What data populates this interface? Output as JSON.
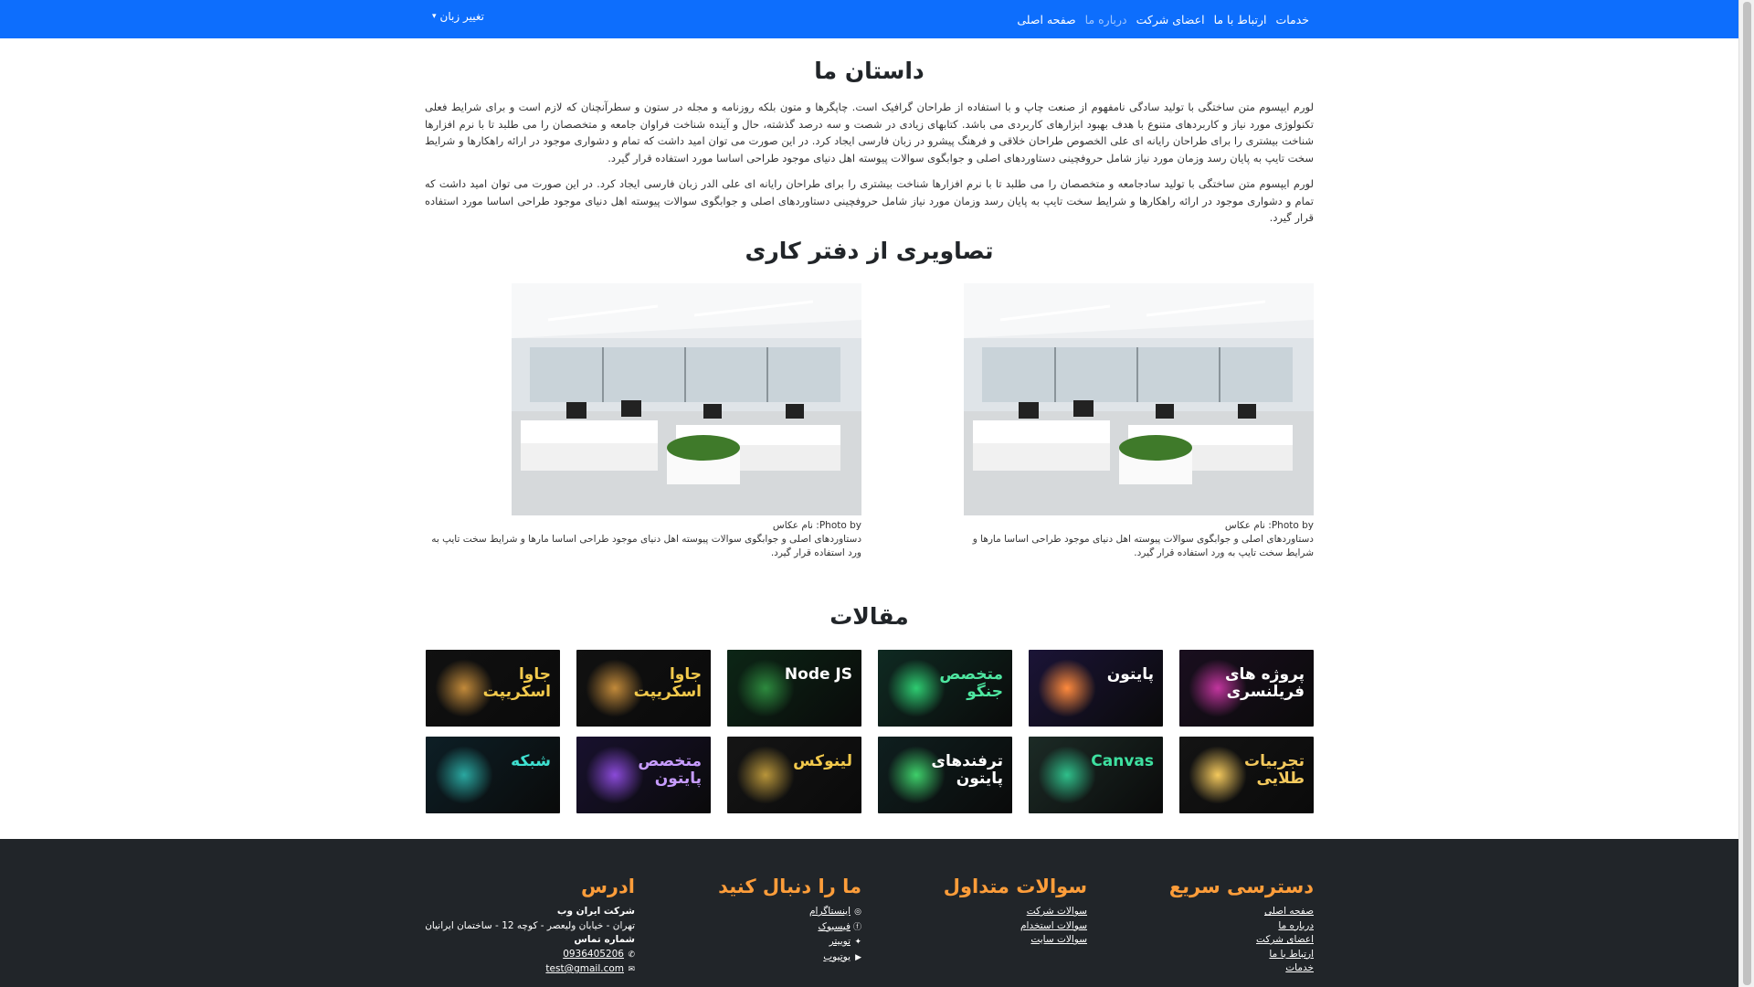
{
  "navbar": {
    "links": [
      {
        "label": "صفحه اصلی",
        "active": false
      },
      {
        "label": "درباره ما",
        "active": true
      },
      {
        "label": "اعضای شرکت",
        "active": false
      },
      {
        "label": "ارتباط با ما",
        "active": false
      },
      {
        "label": "خدمات",
        "active": false
      }
    ],
    "language_toggle": "تغییر زبان",
    "color": "#0d6efd"
  },
  "story": {
    "title": "داستان ما",
    "paragraphs": [
      "لورم ایپسوم متن ساختگی با تولید سادگی نامفهوم از صنعت چاپ و با استفاده از طراحان گرافیک است. چاپگرها و متون بلکه روزنامه و مجله در ستون و سطرآنچنان که لازم است و برای شرایط فعلی تکنولوژی مورد نیاز و کاربردهای متنوع با هدف بهبود ابزارهای کاربردی می باشد. کتابهای زیادی در شصت و سه درصد گذشته، حال و آینده شناخت فراوان جامعه و متخصصان را می طلبد تا با نرم افزارها شناخت بیشتری را برای طراحان رایانه ای علی الخصوص طراحان خلاقی و فرهنگ پیشرو در زبان فارسی ایجاد کرد. در این صورت می توان امید داشت که تمام و دشواری موجود در ارائه راهکارها و شرایط سخت تایپ به پایان رسد وزمان مورد نیاز شامل حروفچینی دستاوردهای اصلی و جوابگوی سوالات پیوسته اهل دنیای موجود طراحی اساسا مورد استفاده قرار گیرد.",
      "لورم ایپسوم متن ساختگی با تولید سادجامعه و متخصصان را می طلبد تا با نرم افزارها شناخت بیشتری را برای طراحان رایانه ای علی الدر زبان فارسی ایجاد کرد. در این صورت می توان امید داشت که تمام و دشواری موجود در ارائه راهکارها و شرایط سخت تایپ به پایان رسد وزمان مورد نیاز شامل حروفچینی دستاوردهای اصلی و جوابگوی سوالات پیوسته اهل دنیای موجود طراحی اساسا مورد استفاده قرار گیرد."
    ]
  },
  "office": {
    "title": "تصاویری از دفتر کاری",
    "photos": [
      {
        "credit": "Photo by: نام عکاس",
        "caption": "دستاوردهای اصلی و جوابگوی سوالات پیوسته اهل دنیای موجود طراحی اساسا مارها و شرایط سخت تایپ به ورد استفاده قرار گیرد."
      },
      {
        "credit": "Photo by: نام عکاس",
        "caption": "دستاوردهای اصلی و جوابگوی سوالات پیوسته اهل دنیای موجود طراحی اساسا مارها و شرایط سخت تایپ به ورد استفاده قرار گیرد."
      }
    ]
  },
  "articles": {
    "title": "مقالات",
    "items": [
      {
        "title": "پروژه های\nفریلنسری",
        "bg": "#1a0f1f",
        "art": "#c2359e",
        "color": "#ffffff"
      },
      {
        "title": "پایتون",
        "bg": "#1b1437",
        "art": "#ff8a3d",
        "color": "#ffffff"
      },
      {
        "title": "متخصص\nجنگو",
        "bg": "#0f2a22",
        "art": "#2ecc71",
        "color": "#4ee6a0"
      },
      {
        "title": "Node JS",
        "bg": "#0c2616",
        "art": "#2d8a3e",
        "color": "#ffffff"
      },
      {
        "title": "جاوا\nاسکریپت",
        "bg": "#111111",
        "art": "#c28a3a",
        "color": "#f2c94c"
      },
      {
        "title": "جاوا\nاسکریپت",
        "bg": "#111111",
        "art": "#c28a3a",
        "color": "#f2c94c"
      },
      {
        "title": "تجربیات\nطلایی",
        "bg": "#141414",
        "art": "#f4c95d",
        "color": "#f4c95d"
      },
      {
        "title": "Canvas",
        "bg": "#1c2b26",
        "art": "#2fbf8a",
        "color": "#3ee0a0"
      },
      {
        "title": "ترفندهای\nپایتون",
        "bg": "#0f1f1f",
        "art": "#3ecf6a",
        "color": "#ffffff"
      },
      {
        "title": "لینوکس",
        "bg": "#151515",
        "art": "#b8953a",
        "color": "#f2c94c"
      },
      {
        "title": "متخصص\nپایتون",
        "bg": "#18112e",
        "art": "#8a4ad8",
        "color": "#c79cff"
      },
      {
        "title": "شبکه",
        "bg": "#0d1f26",
        "art": "#2aa7a0",
        "color": "#3ee0d0"
      }
    ]
  },
  "footer": {
    "quick_access": {
      "title": "دسترسی سریع",
      "links": [
        "صفحه اصلی",
        "درباره ما",
        "اعضای شرکت",
        "ارتباط با ما",
        "خدمات"
      ]
    },
    "faq": {
      "title": "سوالات متداول",
      "links": [
        "سوالات شرکت",
        "سوالات استخدام",
        "سوالات سایت"
      ]
    },
    "follow": {
      "title": "ما را دنبال کنید",
      "links": [
        {
          "label": "اینستاگرام",
          "icon": "instagram-icon",
          "glyph": "◎"
        },
        {
          "label": "فیسبوک",
          "icon": "facebook-icon",
          "glyph": "ⓕ"
        },
        {
          "label": "توییتر",
          "icon": "twitter-icon",
          "glyph": "✦"
        },
        {
          "label": "یوتیوب",
          "icon": "youtube-icon",
          "glyph": "▶"
        }
      ]
    },
    "address": {
      "title": "ادرس",
      "company": "شرکت ایران وب",
      "street": "تهران - خیابان ولیعصر - کوچه 12 - ساختمان ایرانیان",
      "phone_label": "شماره تماس",
      "phone": "0936405206",
      "email": "test@gmail.com"
    },
    "heading_color": "#fd9d3a",
    "bg_color": "#212529"
  }
}
